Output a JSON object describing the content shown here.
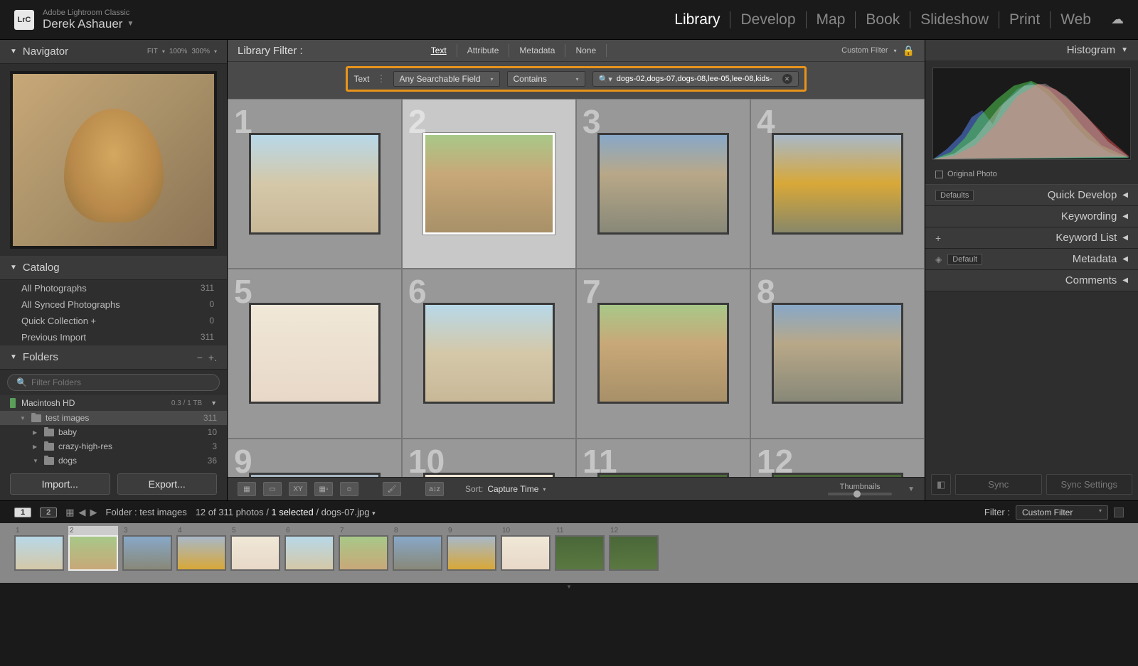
{
  "app": {
    "name": "Adobe Lightroom Classic",
    "logo": "LrC",
    "user": "Derek Ashauer"
  },
  "modules": [
    "Library",
    "Develop",
    "Map",
    "Book",
    "Slideshow",
    "Print",
    "Web"
  ],
  "active_module": "Library",
  "navigator": {
    "title": "Navigator",
    "zoom_modes": [
      "FIT",
      "100%",
      "300%"
    ]
  },
  "catalog": {
    "title": "Catalog",
    "items": [
      {
        "label": "All Photographs",
        "count": "311"
      },
      {
        "label": "All Synced Photographs",
        "count": "0"
      },
      {
        "label": "Quick Collection  +",
        "count": "0"
      },
      {
        "label": "Previous Import",
        "count": "311"
      }
    ]
  },
  "folders": {
    "title": "Folders",
    "search_placeholder": "Filter Folders",
    "volume": {
      "name": "Macintosh HD",
      "stats": "0.3 / 1 TB"
    },
    "tree": [
      {
        "name": "test images",
        "count": "311",
        "level": 0,
        "expanded": true,
        "selected": true
      },
      {
        "name": "baby",
        "count": "10",
        "level": 1
      },
      {
        "name": "crazy-high-res",
        "count": "3",
        "level": 1
      },
      {
        "name": "dogs",
        "count": "36",
        "level": 1,
        "expanded": true
      }
    ]
  },
  "import_label": "Import...",
  "export_label": "Export...",
  "filter_bar": {
    "title": "Library Filter :",
    "tabs": [
      "Text",
      "Attribute",
      "Metadata",
      "None"
    ],
    "active_tab": "Text",
    "preset": "Custom Filter"
  },
  "text_filter": {
    "label": "Text",
    "field": "Any Searchable Field",
    "rule": "Contains",
    "query": "dogs-02,dogs-07,dogs-08,lee-05,lee-08,kids-"
  },
  "grid": {
    "cells": [
      {
        "n": "1",
        "style": "dog1"
      },
      {
        "n": "2",
        "style": "dog2",
        "selected": true
      },
      {
        "n": "3",
        "style": "road"
      },
      {
        "n": "4",
        "style": "kid"
      },
      {
        "n": "5",
        "style": "baby"
      },
      {
        "n": "6",
        "style": "dog1"
      },
      {
        "n": "7",
        "style": "dog2"
      },
      {
        "n": "8",
        "style": "road"
      },
      {
        "n": "9",
        "style": "kid"
      },
      {
        "n": "10",
        "style": "baby"
      },
      {
        "n": "11",
        "style": "grass"
      },
      {
        "n": "12",
        "style": "grass"
      }
    ]
  },
  "toolbar": {
    "sort_label": "Sort:",
    "sort_value": "Capture Time",
    "thumb_label": "Thumbnails"
  },
  "right": {
    "histogram": "Histogram",
    "original_photo": "Original Photo",
    "quick_develop": {
      "title": "Quick Develop",
      "preset": "Defaults"
    },
    "keywording": "Keywording",
    "keyword_list": "Keyword List",
    "metadata": {
      "title": "Metadata",
      "preset": "Default"
    },
    "comments": "Comments",
    "sync": "Sync",
    "sync_settings": "Sync Settings"
  },
  "status": {
    "folder_label": "Folder : test images",
    "stats_prefix": "12 of 311 photos /",
    "selected": "1 selected",
    "filename": "/ dogs-07.jpg",
    "filter_label": "Filter :",
    "filter_value": "Custom Filter"
  },
  "filmstrip": {
    "items": [
      {
        "n": "1",
        "style": "dog1"
      },
      {
        "n": "2",
        "style": "dog2",
        "selected": true
      },
      {
        "n": "3",
        "style": "road"
      },
      {
        "n": "4",
        "style": "kid"
      },
      {
        "n": "5",
        "style": "baby"
      },
      {
        "n": "6",
        "style": "dog1"
      },
      {
        "n": "7",
        "style": "dog2"
      },
      {
        "n": "8",
        "style": "road"
      },
      {
        "n": "9",
        "style": "kid"
      },
      {
        "n": "10",
        "style": "baby"
      },
      {
        "n": "11",
        "style": "grass"
      },
      {
        "n": "12",
        "style": "grass"
      }
    ]
  }
}
